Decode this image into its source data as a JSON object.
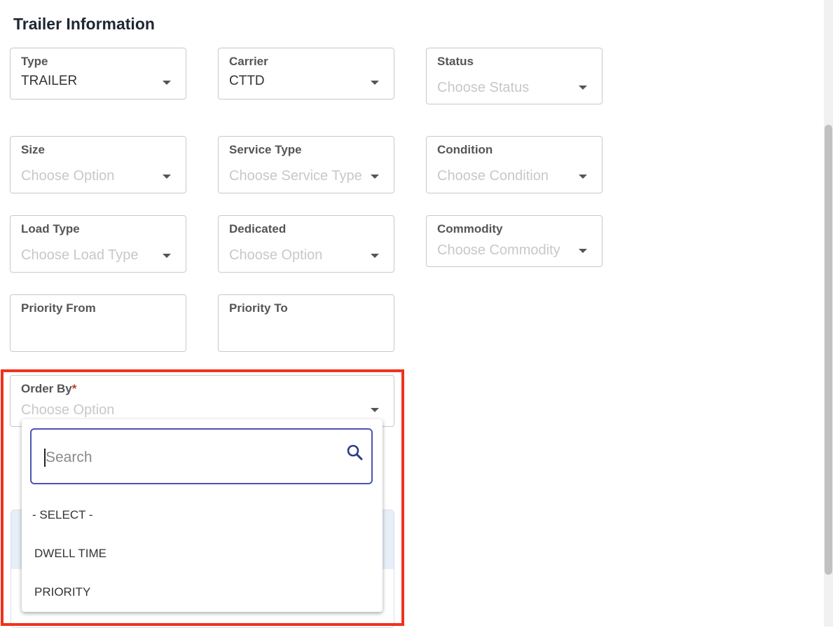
{
  "section_title": "Trailer Information",
  "fields": {
    "type": {
      "label": "Type",
      "value": "TRAILER"
    },
    "carrier": {
      "label": "Carrier",
      "value": "CTTD"
    },
    "status": {
      "label": "Status",
      "placeholder": "Choose Status"
    },
    "size": {
      "label": "Size",
      "placeholder": "Choose Option"
    },
    "service_type": {
      "label": "Service Type",
      "placeholder": "Choose Service Type"
    },
    "condition": {
      "label": "Condition",
      "placeholder": "Choose Condition"
    },
    "load_type": {
      "label": "Load Type",
      "placeholder": "Choose Load Type"
    },
    "dedicated": {
      "label": "Dedicated",
      "placeholder": "Choose Option"
    },
    "commodity": {
      "label": "Commodity",
      "placeholder": "Choose Commodity"
    },
    "priority_from": {
      "label": "Priority From",
      "value": ""
    },
    "priority_to": {
      "label": "Priority To",
      "value": ""
    },
    "order_by": {
      "label": "Order By",
      "required_mark": "*",
      "placeholder": "Choose Option"
    }
  },
  "dropdown": {
    "search_placeholder": "Search",
    "options": [
      "- SELECT -",
      "DWELL TIME",
      "PRIORITY"
    ]
  },
  "icons": {
    "caret": "chevron-down-icon",
    "search": "search-icon"
  },
  "colors": {
    "highlight": "#f0321c",
    "search_border": "#4a55b5",
    "required": "#c0392b"
  }
}
